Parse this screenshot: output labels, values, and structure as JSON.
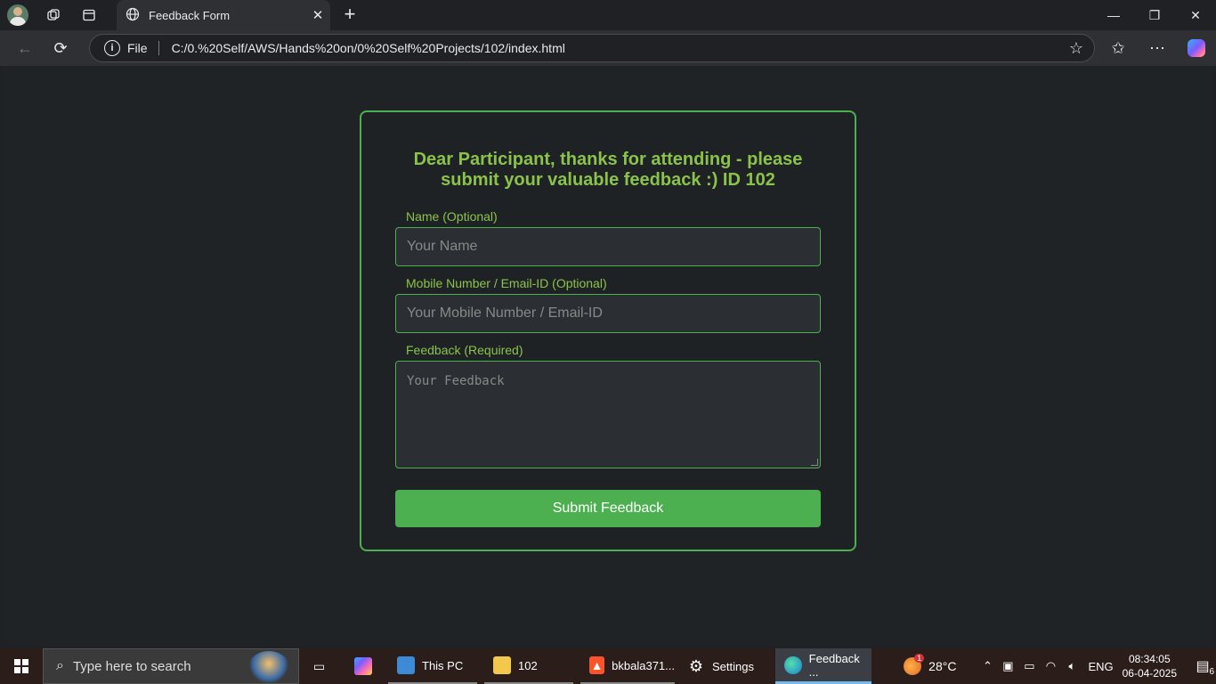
{
  "browser": {
    "tab_title": "Feedback Form",
    "address_scheme": "File",
    "address_url": "C:/0.%20Self/AWS/Hands%20on/0%20Self%20Projects/102/index.html"
  },
  "form": {
    "heading": "Dear Participant, thanks for attending - please submit your valuable feedback :) ID 102",
    "name_label": "Name (Optional)",
    "name_placeholder": "Your Name",
    "contact_label": "Mobile Number / Email-ID (Optional)",
    "contact_placeholder": "Your Mobile Number / Email-ID",
    "feedback_label": "Feedback (Required)",
    "feedback_placeholder": "Your Feedback",
    "submit_label": "Submit Feedback"
  },
  "taskbar": {
    "search_placeholder": "Type here to search",
    "apps": [
      {
        "label": "This PC"
      },
      {
        "label": "102"
      },
      {
        "label": "bkbala371..."
      },
      {
        "label": "Settings"
      },
      {
        "label": "Feedback ..."
      }
    ],
    "weather": "28°C",
    "weather_badge": "1",
    "language": "ENG",
    "time": "08:34:05",
    "date": "06-04-2025",
    "notification_count": "6"
  },
  "colors": {
    "accent_green": "#4caf50",
    "label_green": "#8bc34a",
    "page_bg": "#202326"
  }
}
